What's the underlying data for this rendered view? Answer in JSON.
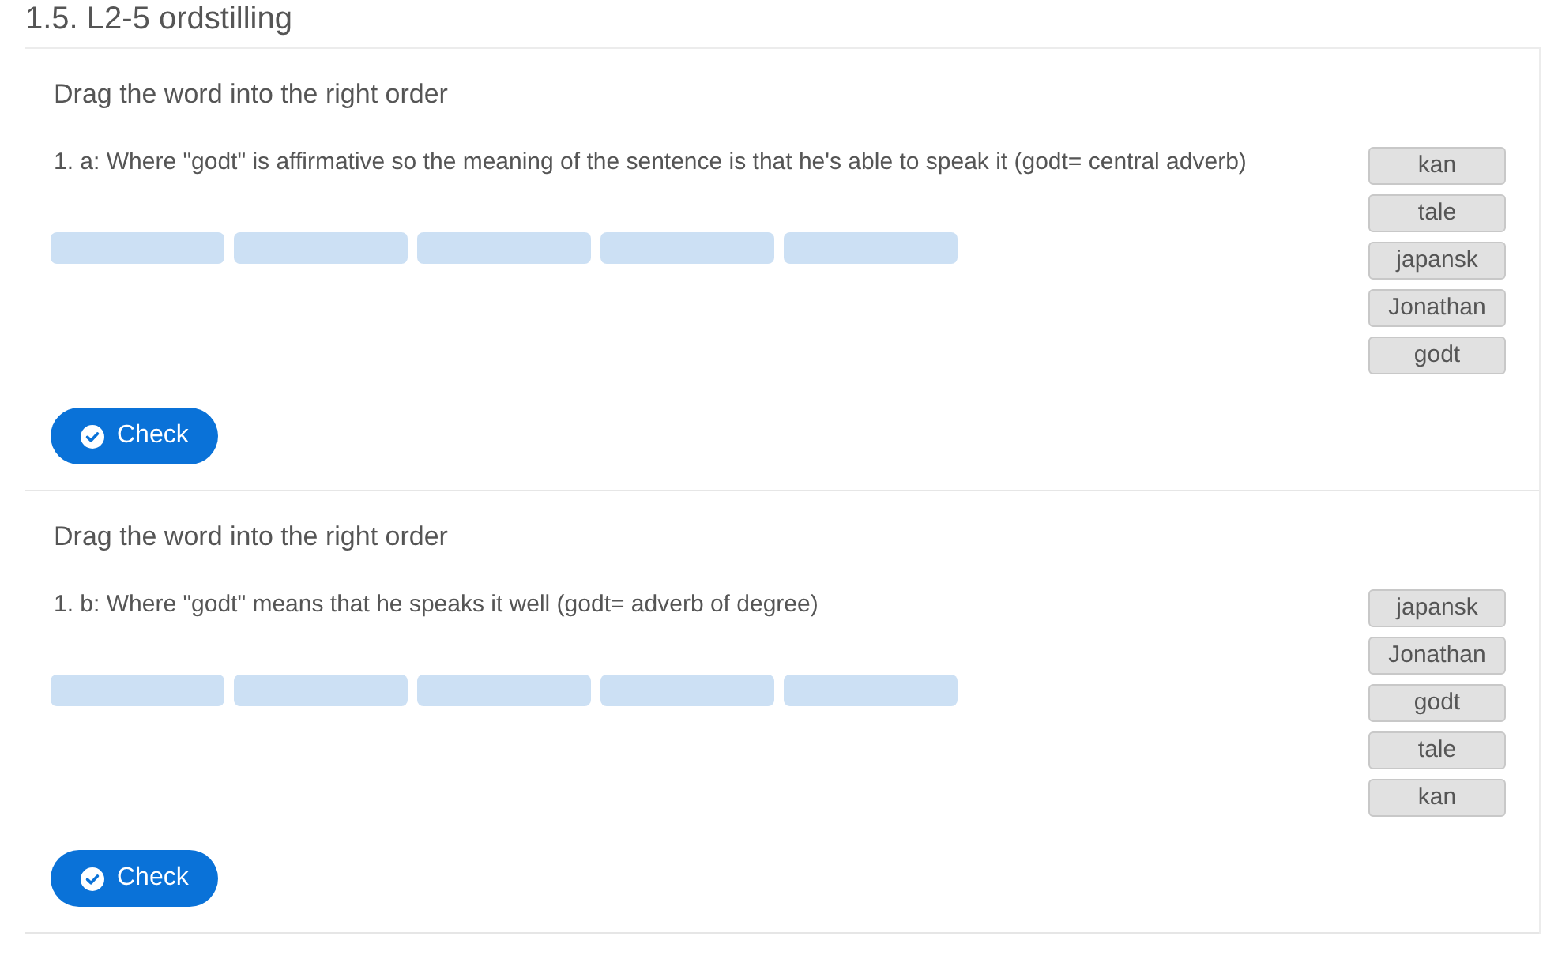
{
  "page_title": "1.5. L2-5 ordstilling",
  "exercises": [
    {
      "instruction": "Drag the word into the right order",
      "question": "1. a: Where \"godt\" is affirmative so the meaning of the sentence is that he's able to speak it (godt= central adverb)",
      "slots": [
        {
          "filled": false
        },
        {
          "filled": false
        },
        {
          "filled": false
        },
        {
          "filled": false
        },
        {
          "filled": false
        }
      ],
      "words": [
        "kan",
        "tale",
        "japansk",
        "Jonathan",
        "godt"
      ],
      "check_button": "Check"
    },
    {
      "instruction": "Drag the word into the right order",
      "question": "1. b: Where \"godt\" means that he speaks it well (godt= adverb of degree)",
      "slots": [
        {
          "filled": false
        },
        {
          "filled": false
        },
        {
          "filled": false
        },
        {
          "filled": false
        },
        {
          "filled": false
        }
      ],
      "words": [
        "japansk",
        "Jonathan",
        "godt",
        "tale",
        "kan"
      ],
      "check_button": "Check"
    }
  ]
}
